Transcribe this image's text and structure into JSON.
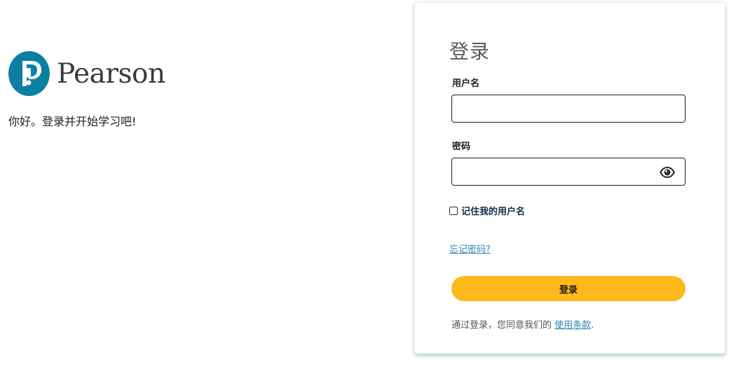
{
  "brand": {
    "name": "Pearson",
    "welcome": "你好。登录并开始学习吧!",
    "logo_color": "#0b7fa3"
  },
  "login": {
    "title": "登录",
    "username_label": "用户名",
    "username_value": "",
    "password_label": "密码",
    "password_value": "",
    "remember_label": "记住我的用户名",
    "forgot_link": "忘记密码?",
    "submit_label": "登录",
    "terms_prefix": "通过登录，您同意我们的",
    "terms_link": "使用条款",
    "terms_suffix": ".",
    "accent_color": "#ffb81c",
    "link_color": "#2b8aae"
  }
}
